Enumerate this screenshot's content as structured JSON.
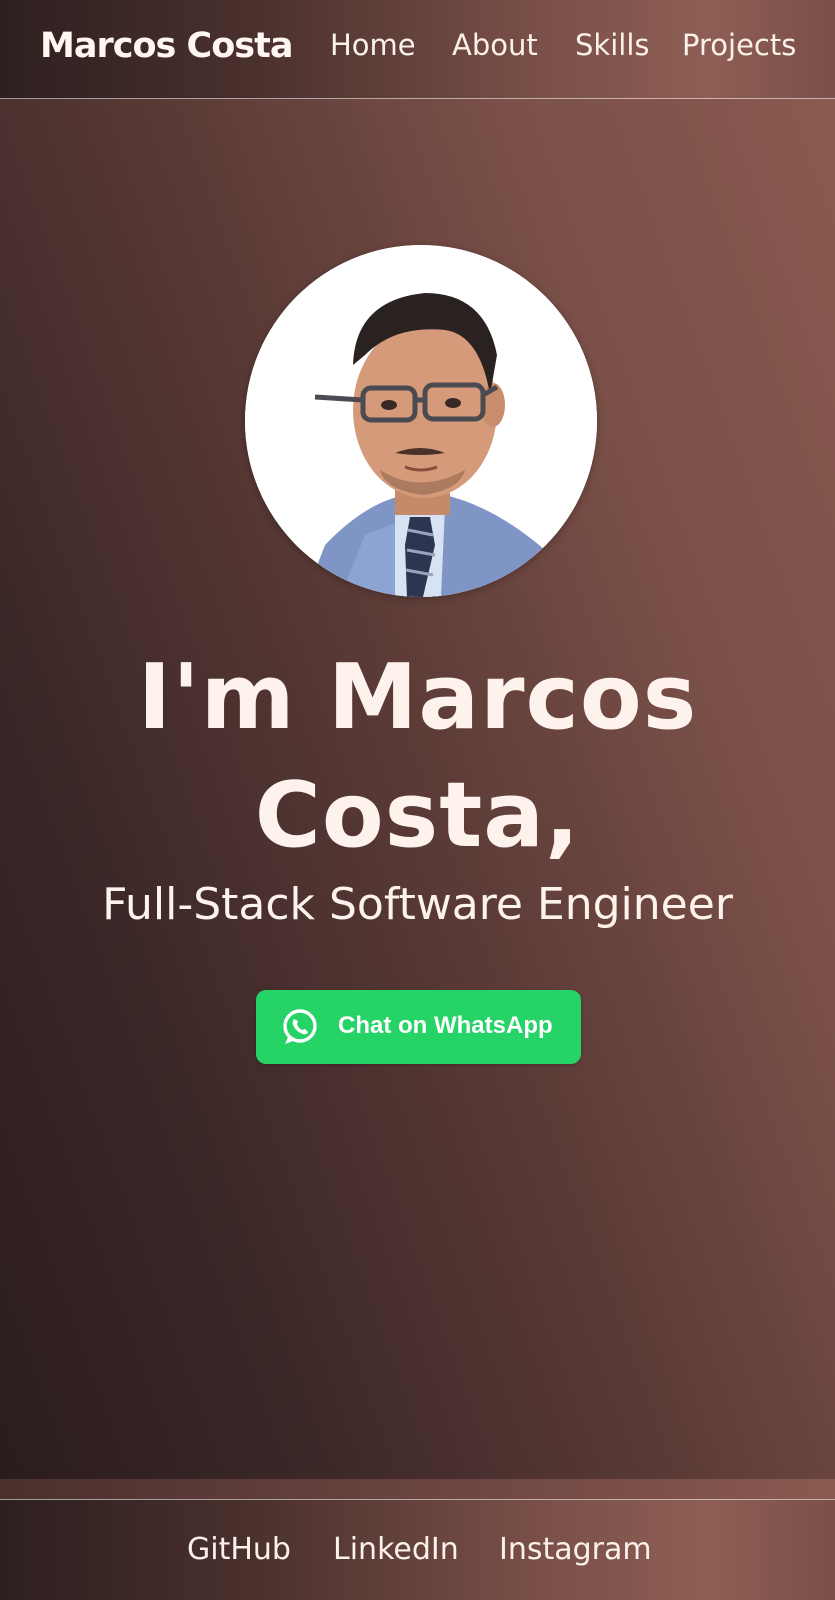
{
  "header": {
    "brand": "Marcos Costa",
    "nav": [
      "Home",
      "About",
      "Skills",
      "Projects"
    ]
  },
  "hero": {
    "headline_line1": "I'm Marcos",
    "headline_line2": "Costa,",
    "subtitle": "Full-Stack Software Engineer",
    "cta_label": "Chat on WhatsApp",
    "cta_icon": "whatsapp-icon"
  },
  "footer": {
    "links": [
      "GitHub",
      "LinkedIn",
      "Instagram"
    ]
  },
  "colors": {
    "whatsapp_green": "#25d366",
    "text": "#fbf1ea",
    "dark_brown": "#2d1f20",
    "light_brown": "#8e5e54"
  }
}
